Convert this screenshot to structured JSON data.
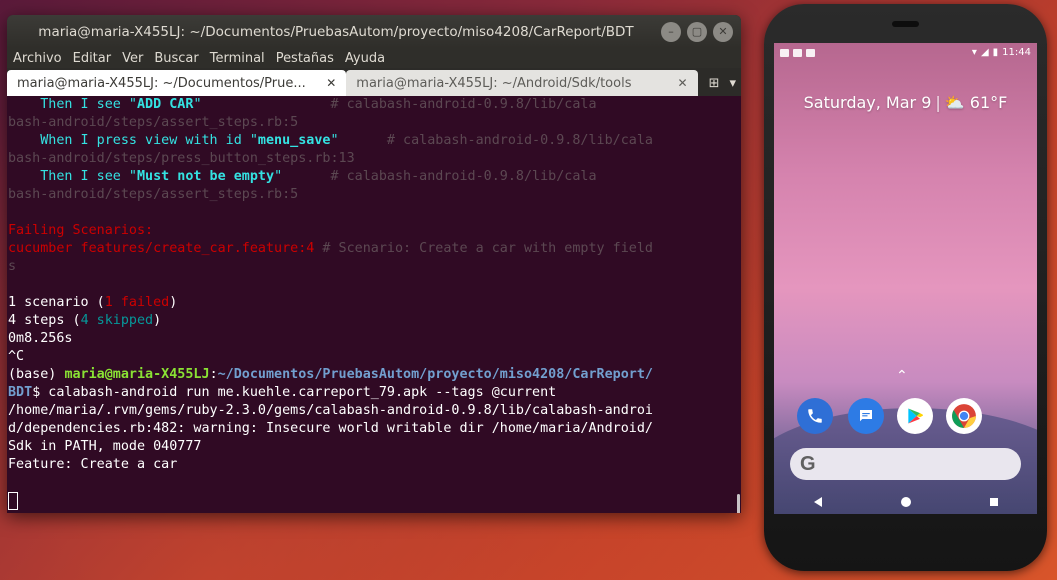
{
  "terminal": {
    "window_title": "maria@maria-X455LJ: ~/Documentos/PruebasAutom/proyecto/miso4208/CarReport/BDT",
    "menu": [
      "Archivo",
      "Editar",
      "Ver",
      "Buscar",
      "Terminal",
      "Pestañas",
      "Ayuda"
    ],
    "tabs": [
      {
        "label": "maria@maria-X455LJ: ~/Documentos/Prue..."
      },
      {
        "label": "maria@maria-X455LJ: ~/Android/Sdk/tools"
      }
    ],
    "lines": {
      "l1a": "    Then I see \"",
      "l1b": "ADD CAR",
      "l1c": "\"",
      "l1d": "                # calabash-android-0.9.8/lib/cala",
      "l2": "bash-android/steps/assert_steps.rb:5",
      "l3a": "    When I press view with id \"",
      "l3b": "menu_save",
      "l3c": "\"",
      "l3d": "      # calabash-android-0.9.8/lib/cala",
      "l4": "bash-android/steps/press_button_steps.rb:13",
      "l5a": "    Then I see \"",
      "l5b": "Must not be empty",
      "l5c": "\"",
      "l5d": "      # calabash-android-0.9.8/lib/cala",
      "l6": "bash-android/steps/assert_steps.rb:5",
      "l8": "Failing Scenarios:",
      "l9a": "cucumber features/create_car.feature:4",
      "l9b": " # Scenario: Create a car with empty field",
      "l10": "s",
      "l12a": "1 scenario (",
      "l12b": "1 failed",
      "l12c": ")",
      "l13a": "4 steps (",
      "l13b": "4 skipped",
      "l13c": ")",
      "l14": "0m8.256s",
      "l15": "^C",
      "l16a": "(base) ",
      "l16b": "maria@maria-X455LJ",
      "l16c": ":",
      "l16d": "~/Documentos/PruebasAutom/proyecto/miso4208/CarReport/",
      "l17a": "BDT",
      "l17b": "$ calabash-android run me.kuehle.carreport_79.apk --tags @current",
      "l18": "/home/maria/.rvm/gems/ruby-2.3.0/gems/calabash-android-0.9.8/lib/calabash-androi",
      "l19": "d/dependencies.rb:482: warning: Insecure world writable dir /home/maria/Android/",
      "l20": "Sdk in PATH, mode 040777",
      "l21": "Feature: Create a car"
    }
  },
  "phone": {
    "status_time": "11:44",
    "date": "Saturday, Mar 9",
    "weather": "61°F",
    "search_glyph": "G",
    "dock_icons": [
      "phone-icon",
      "messages-icon",
      "play-store-icon",
      "chrome-icon"
    ],
    "colors": {
      "phone": "#2f6fd6",
      "messages": "#2d7be5",
      "accent": "#34e2e2"
    }
  }
}
